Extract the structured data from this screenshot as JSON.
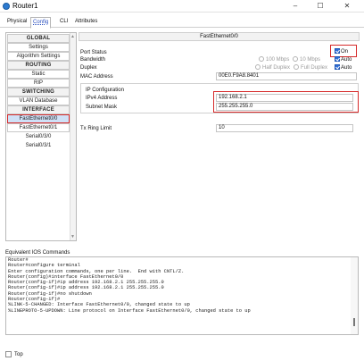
{
  "window": {
    "title": "Router1",
    "minimize": "–",
    "maximize": "☐",
    "close": "✕"
  },
  "tabs": [
    "Physical",
    "Config",
    "CLI",
    "Attributes"
  ],
  "sidebar": {
    "items": [
      {
        "label": "GLOBAL",
        "kind": "header"
      },
      {
        "label": "Settings",
        "kind": "item"
      },
      {
        "label": "Algorithm Settings",
        "kind": "item"
      },
      {
        "label": "ROUTING",
        "kind": "header"
      },
      {
        "label": "Static",
        "kind": "item"
      },
      {
        "label": "RIP",
        "kind": "item"
      },
      {
        "label": "SWITCHING",
        "kind": "header"
      },
      {
        "label": "VLAN Database",
        "kind": "item"
      },
      {
        "label": "INTERFACE",
        "kind": "header"
      },
      {
        "label": "FastEthernet0/0",
        "kind": "item",
        "selected": true
      },
      {
        "label": "FastEthernet0/1",
        "kind": "item"
      },
      {
        "label": "Serial0/3/0",
        "kind": "sub"
      },
      {
        "label": "Serial0/3/1",
        "kind": "sub"
      }
    ]
  },
  "panel": {
    "title": "FastEthernet0/0",
    "port_status_label": "Port Status",
    "on_label": "On",
    "bandwidth_label": "Bandwidth",
    "bw_100": "100 Mbps",
    "bw_10": "10 Mbps",
    "bw_auto": "Auto",
    "duplex_label": "Duplex",
    "half": "Half Duplex",
    "full": "Full Duplex",
    "duplex_auto": "Auto",
    "mac_label": "MAC Address",
    "mac_value": "00E0.F9A8.8401",
    "ipconfig_label": "IP Configuration",
    "ipv4_label": "IPv4 Address",
    "ipv4_value": "192.168.2.1",
    "mask_label": "Subnet Mask",
    "mask_value": "255.255.255.0",
    "txring_label": "Tx Ring Limit",
    "txring_value": "10"
  },
  "ios": {
    "label": "Equivalent IOS Commands",
    "lines": [
      "Router#",
      "Router#configure terminal",
      "Enter configuration commands, one per line.  End with CNTL/Z.",
      "Router(config)#interface FastEthernet0/0",
      "Router(config-if)#ip address 192.168.2.1 255.255.255.0",
      "Router(config-if)#ip address 192.168.2.1 255.255.255.0",
      "Router(config-if)#no shutdown",
      "Router(config-if)#",
      "%LINK-5-CHANGED: Interface FastEthernet0/0, changed state to up",
      "",
      "%LINEPROTO-5-UPDOWN: Line protocol on Interface FastEthernet0/0, changed state to up"
    ]
  },
  "footer": {
    "top_label": "Top"
  }
}
